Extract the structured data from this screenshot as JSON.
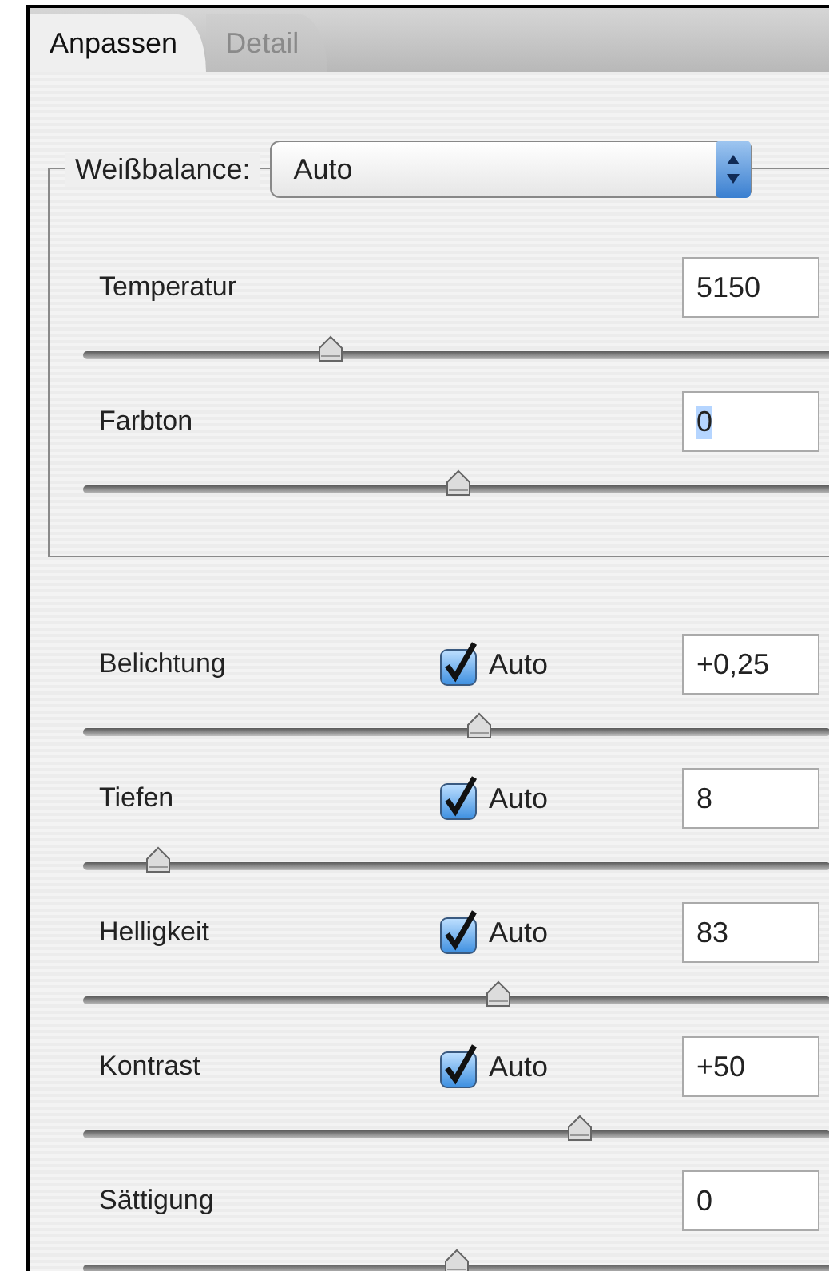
{
  "tabs": [
    {
      "label": "Anpassen",
      "selected": true
    },
    {
      "label": "Detail",
      "selected": false
    }
  ],
  "white_balance": {
    "label": "Weißbalance:",
    "value": "Auto",
    "sliders": [
      {
        "label": "Temperatur",
        "value": "5150",
        "text_selected": false,
        "level": 0.33
      },
      {
        "label": "Farbton",
        "value": "0",
        "text_selected": true,
        "level": 0.5
      }
    ]
  },
  "adjustments": [
    {
      "kind": "auto",
      "label": "Belichtung",
      "auto": {
        "label": "Auto",
        "checked": true
      },
      "value": "+0,25",
      "level": 0.53
    },
    {
      "kind": "auto",
      "label": "Tiefen",
      "auto": {
        "label": "Auto",
        "checked": true
      },
      "value": "8",
      "level": 0.1
    },
    {
      "kind": "auto",
      "label": "Helligkeit",
      "auto": {
        "label": "Auto",
        "checked": true
      },
      "value": "83",
      "level": 0.555
    },
    {
      "kind": "auto",
      "label": "Kontrast",
      "auto": {
        "label": "Auto",
        "checked": true
      },
      "value": "+50",
      "level": 0.665
    },
    {
      "kind": "plain",
      "label": "Sättigung",
      "value": "0",
      "level": 0.5
    }
  ]
}
